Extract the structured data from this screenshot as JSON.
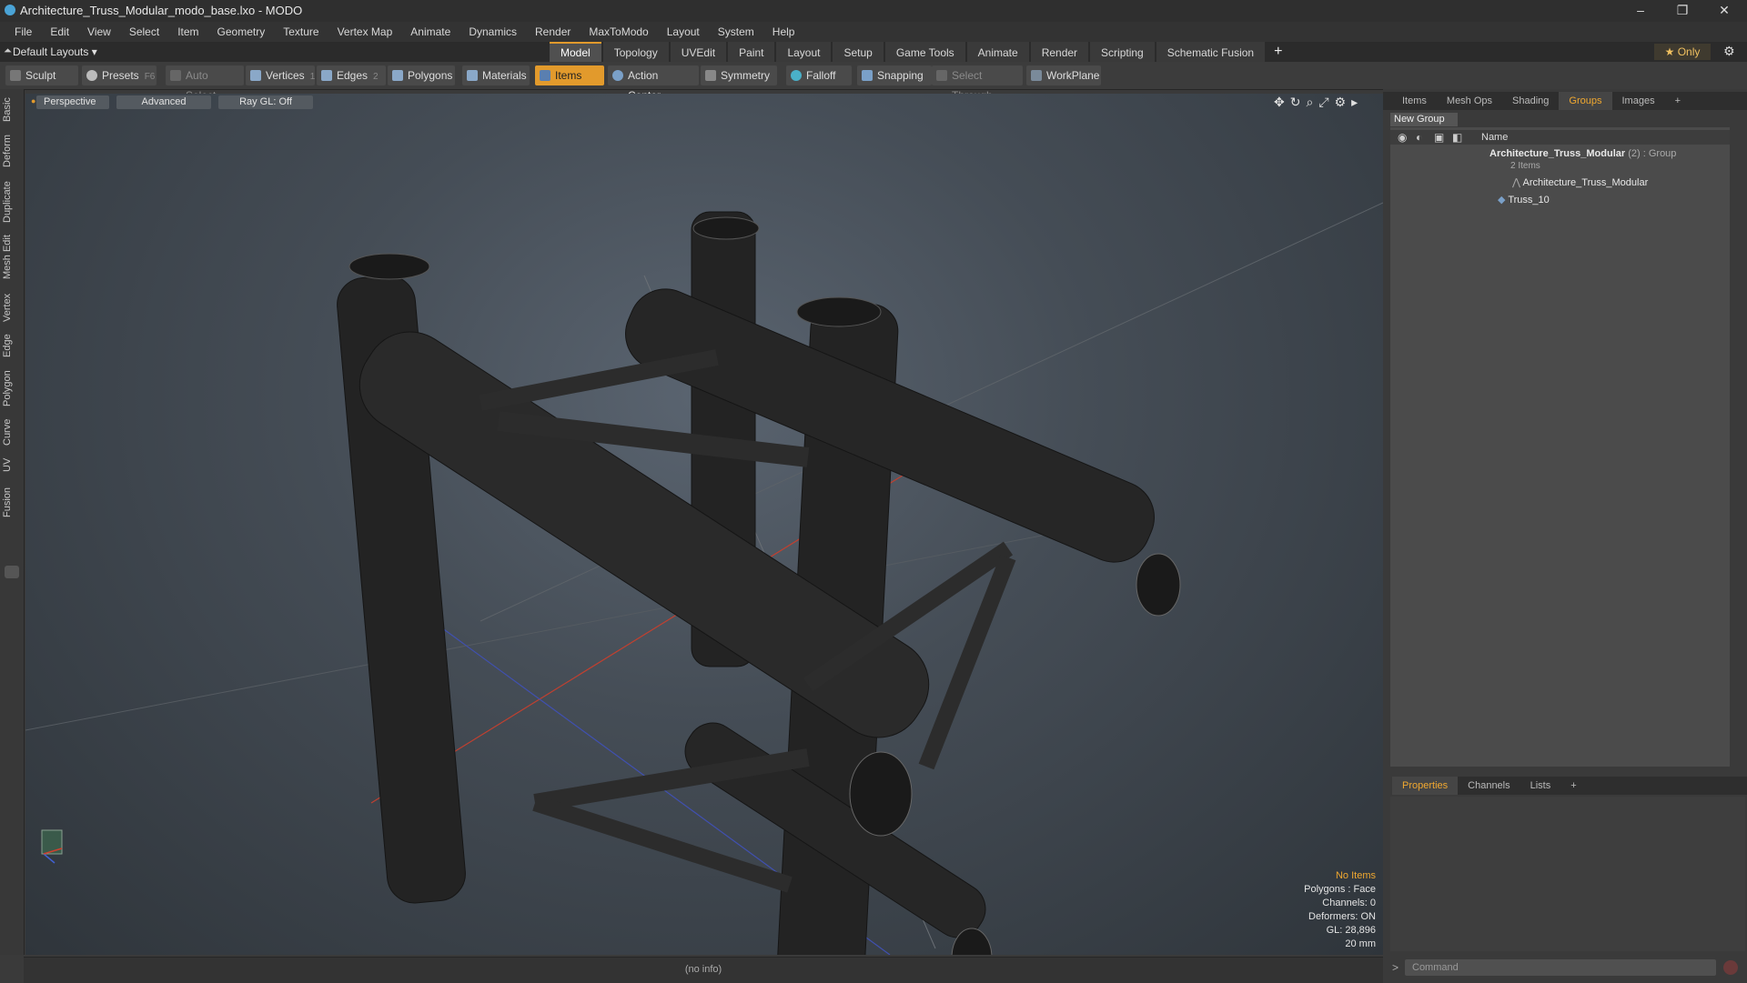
{
  "window": {
    "title": "Architecture_Truss_Modular_modo_base.lxo - MODO",
    "controls": [
      "–",
      "❐",
      "✕"
    ]
  },
  "menu": [
    "File",
    "Edit",
    "View",
    "Select",
    "Item",
    "Geometry",
    "Texture",
    "Vertex Map",
    "Animate",
    "Dynamics",
    "Render",
    "MaxToModo",
    "Layout",
    "System",
    "Help"
  ],
  "layout_selector": "Default Layouts ▾",
  "mode_tabs": [
    "Model",
    "Topology",
    "UVEdit",
    "Paint",
    "Layout",
    "Setup",
    "Game Tools",
    "Animate",
    "Render",
    "Scripting",
    "Schematic Fusion"
  ],
  "mode_tabs_active": "Model",
  "only_button": "★ Only",
  "toolbar": {
    "sculpt": "Sculpt",
    "presets": "Presets",
    "presets_key": "F6",
    "auto_select": "Auto Select",
    "vertices": "Vertices",
    "vertices_key": "1",
    "edges": "Edges",
    "edges_key": "2",
    "polygons": "Polygons",
    "materials": "Materials",
    "items": "Items",
    "action_center": "Action Center",
    "symmetry": "Symmetry",
    "falloff": "Falloff",
    "snapping": "Snapping",
    "select_through": "Select Through",
    "workplane": "WorkPlane"
  },
  "left_tabs": [
    "Basic",
    "Deform",
    "Duplicate",
    "Mesh Edit",
    "Vertex",
    "Edge",
    "Polygon",
    "Curve",
    "UV",
    "Fusion"
  ],
  "viewport": {
    "view": "Perspective",
    "shading": "Advanced",
    "raygl": "Ray GL: Off",
    "hud": {
      "no_items": "No Items",
      "polygons": "Polygons : Face",
      "channels": "Channels: 0",
      "deformers": "Deformers: ON",
      "gl": "GL: 28,896",
      "scale": "20 mm"
    }
  },
  "status": "(no info)",
  "right_panel": {
    "top_tabs": [
      "Items",
      "Mesh Ops",
      "Shading",
      "Groups",
      "Images"
    ],
    "top_active": "Groups",
    "new_group": "New Group",
    "col_name": "Name",
    "group_name": "Architecture_Truss_Modular",
    "group_count": "(2)",
    "group_type": ": Group",
    "group_sub": "2 Items",
    "child1": "Architecture_Truss_Modular",
    "child2": "Truss_10",
    "bottom_tabs": [
      "Properties",
      "Channels",
      "Lists"
    ],
    "bottom_active": "Properties",
    "command_placeholder": "Command"
  },
  "colors": {
    "accent": "#e29a2c",
    "highlight_text": "#f0a830",
    "viewport_bg": "#454d56"
  }
}
